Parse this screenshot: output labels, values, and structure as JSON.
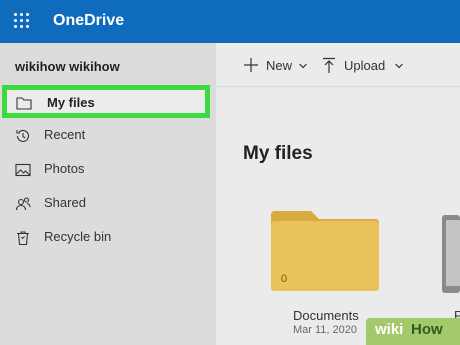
{
  "app": {
    "title": "OneDrive"
  },
  "sidebar": {
    "user_name": "wikihow wikihow",
    "items": [
      {
        "label": "My files",
        "icon": "folder-icon",
        "active": true
      },
      {
        "label": "Recent",
        "icon": "history-icon"
      },
      {
        "label": "Photos",
        "icon": "image-icon"
      },
      {
        "label": "Shared",
        "icon": "people-icon"
      },
      {
        "label": "Recycle bin",
        "icon": "trash-icon"
      }
    ]
  },
  "toolbar": {
    "new_label": "New",
    "upload_label": "Upload"
  },
  "main": {
    "heading": "My files",
    "items": [
      {
        "name": "Documents",
        "date": "Mar 11, 2020",
        "count": "0",
        "type": "folder"
      },
      {
        "name": "P",
        "type": "device"
      }
    ]
  },
  "watermark": {
    "wiki": "wiki",
    "how": "How"
  },
  "colors": {
    "brand": "#0f6cbd",
    "highlight": "#3cd940",
    "folder": "#e9c25a",
    "watermark": "#a4c96b"
  }
}
